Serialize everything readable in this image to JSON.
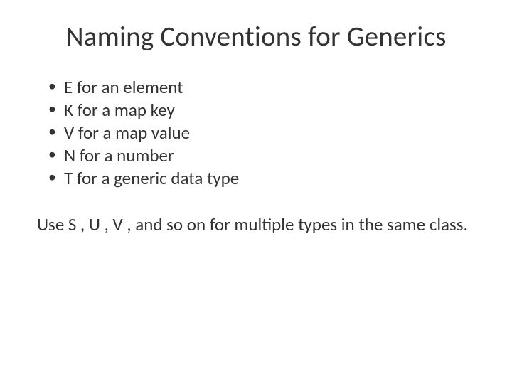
{
  "title": "Naming Conventions for Generics",
  "bullets": [
    "E for an element",
    "K for a map key",
    "V for a map value",
    "N for a number",
    "T for a generic data type"
  ],
  "note": "Use S , U , V , and so on for multiple types in the same class."
}
